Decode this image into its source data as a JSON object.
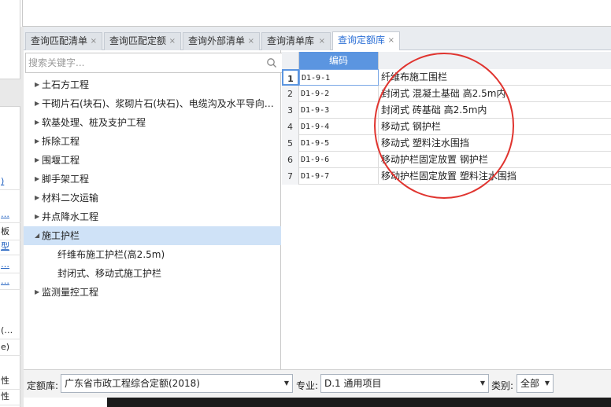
{
  "left_strip": {
    "cells": [
      ")",
      "…",
      "板",
      "型",
      "…",
      "…",
      "(…",
      "e)",
      "性",
      "性"
    ]
  },
  "tabs": [
    {
      "label": "查询匹配清单",
      "close": "×"
    },
    {
      "label": "查询匹配定额",
      "close": "×"
    },
    {
      "label": "查询外部清单",
      "close": "×"
    },
    {
      "label": "查询清单库",
      "close": "×"
    },
    {
      "label": "查询定额库",
      "close": "×"
    }
  ],
  "search": {
    "placeholder": "搜索关键字..."
  },
  "tree": [
    {
      "label": "土石方工程",
      "arrow": "▶"
    },
    {
      "label": "干砌片石(块石)、浆砌片石(块石)、电缆沟及水平导向…",
      "arrow": "▶"
    },
    {
      "label": "软基处理、桩及支护工程",
      "arrow": "▶"
    },
    {
      "label": "拆除工程",
      "arrow": "▶"
    },
    {
      "label": "围堰工程",
      "arrow": "▶"
    },
    {
      "label": "脚手架工程",
      "arrow": "▶"
    },
    {
      "label": "材料二次运输",
      "arrow": "▶"
    },
    {
      "label": "井点降水工程",
      "arrow": "▶"
    },
    {
      "label": "施工护栏",
      "arrow": "◢"
    },
    {
      "label": "纤维布施工护栏(高2.5m)",
      "arrow": ""
    },
    {
      "label": "封闭式、移动式施工护栏",
      "arrow": ""
    },
    {
      "label": "监测量控工程",
      "arrow": "▶"
    }
  ],
  "grid": {
    "header_code": "编码",
    "rows": [
      {
        "num": "1",
        "code": "D1-9-1",
        "name": "纤维布施工围栏"
      },
      {
        "num": "2",
        "code": "D1-9-2",
        "name": "封闭式 混凝土基础 高2.5m内"
      },
      {
        "num": "3",
        "code": "D1-9-3",
        "name": "封闭式 砖基础 高2.5m内"
      },
      {
        "num": "4",
        "code": "D1-9-4",
        "name": "移动式 钢护栏"
      },
      {
        "num": "5",
        "code": "D1-9-5",
        "name": "移动式 塑料注水围挡"
      },
      {
        "num": "6",
        "code": "D1-9-6",
        "name": "移动护栏固定放置 钢护栏"
      },
      {
        "num": "7",
        "code": "D1-9-7",
        "name": "移动护栏固定放置 塑料注水围挡"
      }
    ]
  },
  "bottom": {
    "lib_label": "定额库:",
    "lib_value": "广东省市政工程综合定额(2018)",
    "major_label": "专业:",
    "major_value": "D.1 通用项目",
    "category_label": "类别:",
    "category_value": "全部"
  },
  "colors": {
    "accent": "#5b95e0",
    "annotation": "#e0342f",
    "active_tab_text": "#2b6fd6"
  }
}
